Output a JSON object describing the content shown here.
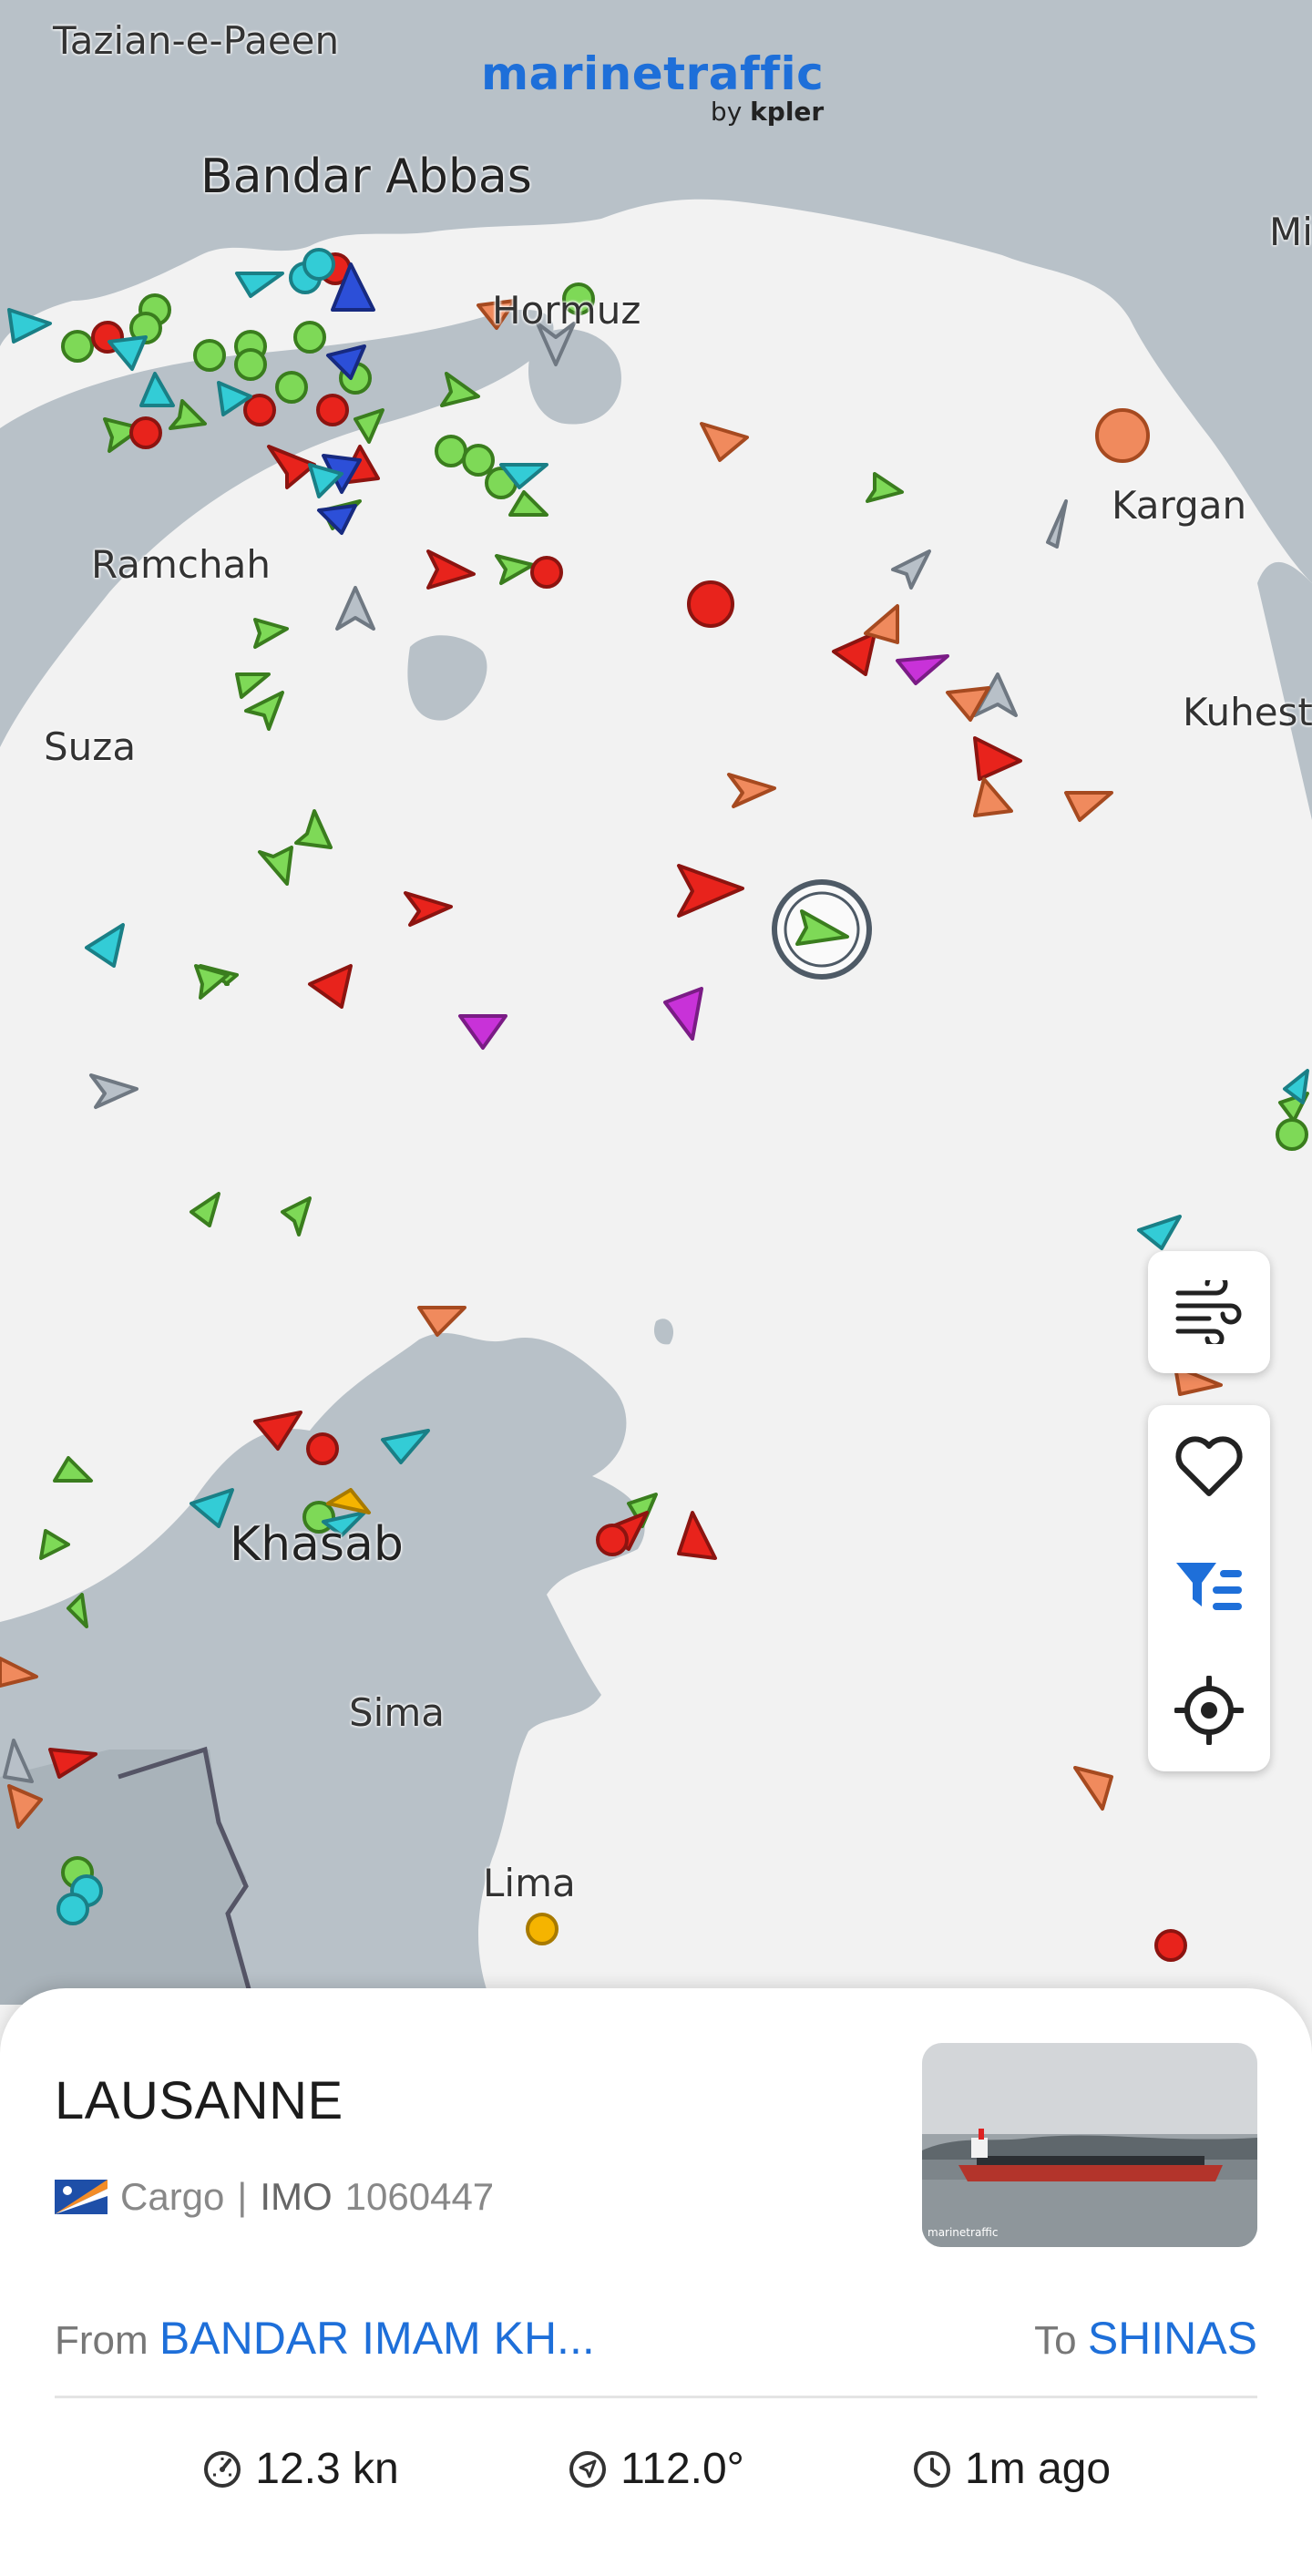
{
  "app": {
    "logo_brand": "marinetraffic",
    "logo_by": "by",
    "logo_partner": "kpler"
  },
  "map": {
    "places": [
      {
        "key": "tazian",
        "name": "Tazian-e-Paeen"
      },
      {
        "key": "bandar_abbas",
        "name": "Bandar Abbas"
      },
      {
        "key": "hormuz",
        "name": "Hormuz"
      },
      {
        "key": "mi",
        "name": "Mi"
      },
      {
        "key": "kargan",
        "name": "Kargan"
      },
      {
        "key": "ramchah",
        "name": "Ramchah"
      },
      {
        "key": "kuhest",
        "name": "Kuhest"
      },
      {
        "key": "suza",
        "name": "Suza"
      },
      {
        "key": "khasab",
        "name": "Khasab"
      },
      {
        "key": "sima",
        "name": "Sima"
      },
      {
        "key": "lima",
        "name": "Lima"
      }
    ],
    "colors": {
      "sea": "#f2f2f2",
      "land": "#b8c1c8",
      "land_dark": "#a9b3ba",
      "cargo": "#7ed957",
      "tanker": "#e8231c",
      "passenger": "#2c4fd8",
      "tug_special": "#33ccd6",
      "unspecified": "#9ba4ad",
      "fishing": "#f08a5d",
      "pleasure": "#c832d8",
      "high_speed": "#f5b400"
    }
  },
  "controls": {
    "wind_icon": "wind-icon",
    "favorite_icon": "heart-icon",
    "filter_icon": "filter-icon",
    "locate_icon": "crosshair-icon"
  },
  "vessel": {
    "name": "LAUSANNE",
    "flag": "Marshall Islands",
    "type": "Cargo",
    "separator": "|",
    "imo_label": "IMO",
    "imo": "1060447",
    "from_label": "From",
    "from_port": "BANDAR IMAM KH...",
    "to_label": "To",
    "to_port": "SHINAS",
    "speed": "12.3 kn",
    "course": "112.0°",
    "last_update": "1m ago",
    "photo_watermark": "marinetraffic"
  }
}
